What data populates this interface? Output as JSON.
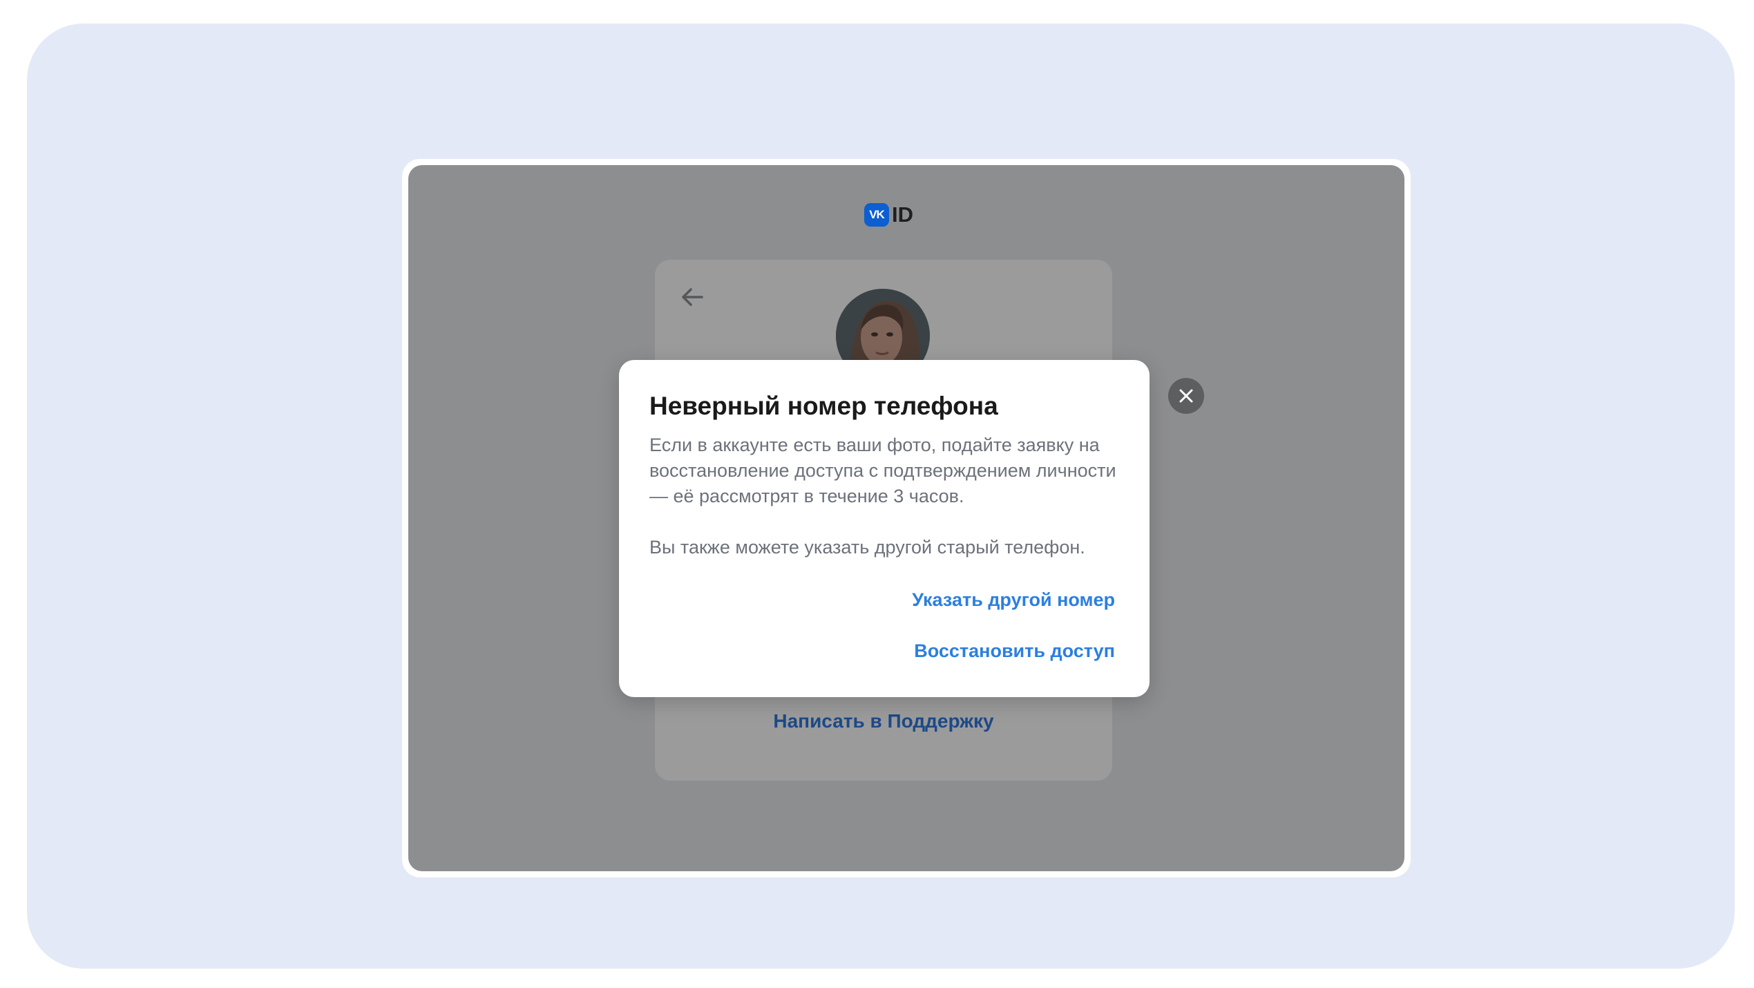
{
  "logo": {
    "badge_text": "VK",
    "id_text": "ID",
    "brand_color": "#0b5fd0"
  },
  "background_card": {
    "back_icon": "arrow-left-icon",
    "support_link": "Написать в Поддержку"
  },
  "dialog": {
    "title": "Неверный номер телефона",
    "paragraph_1": "Если в аккаунте есть ваши фото, подайте заявку на восстановление доступа с подтверждением личности — её рассмотрят в течение 3 часов.",
    "paragraph_2": "Вы также можете указать другой старый телефон.",
    "action_other_number": "Указать другой номер",
    "action_restore_access": "Восстановить доступ",
    "close_icon": "close-icon",
    "accent_color": "#2b7fe0"
  },
  "colors": {
    "outer_background": "#e4e9f7",
    "overlay": "#8d8e90"
  }
}
